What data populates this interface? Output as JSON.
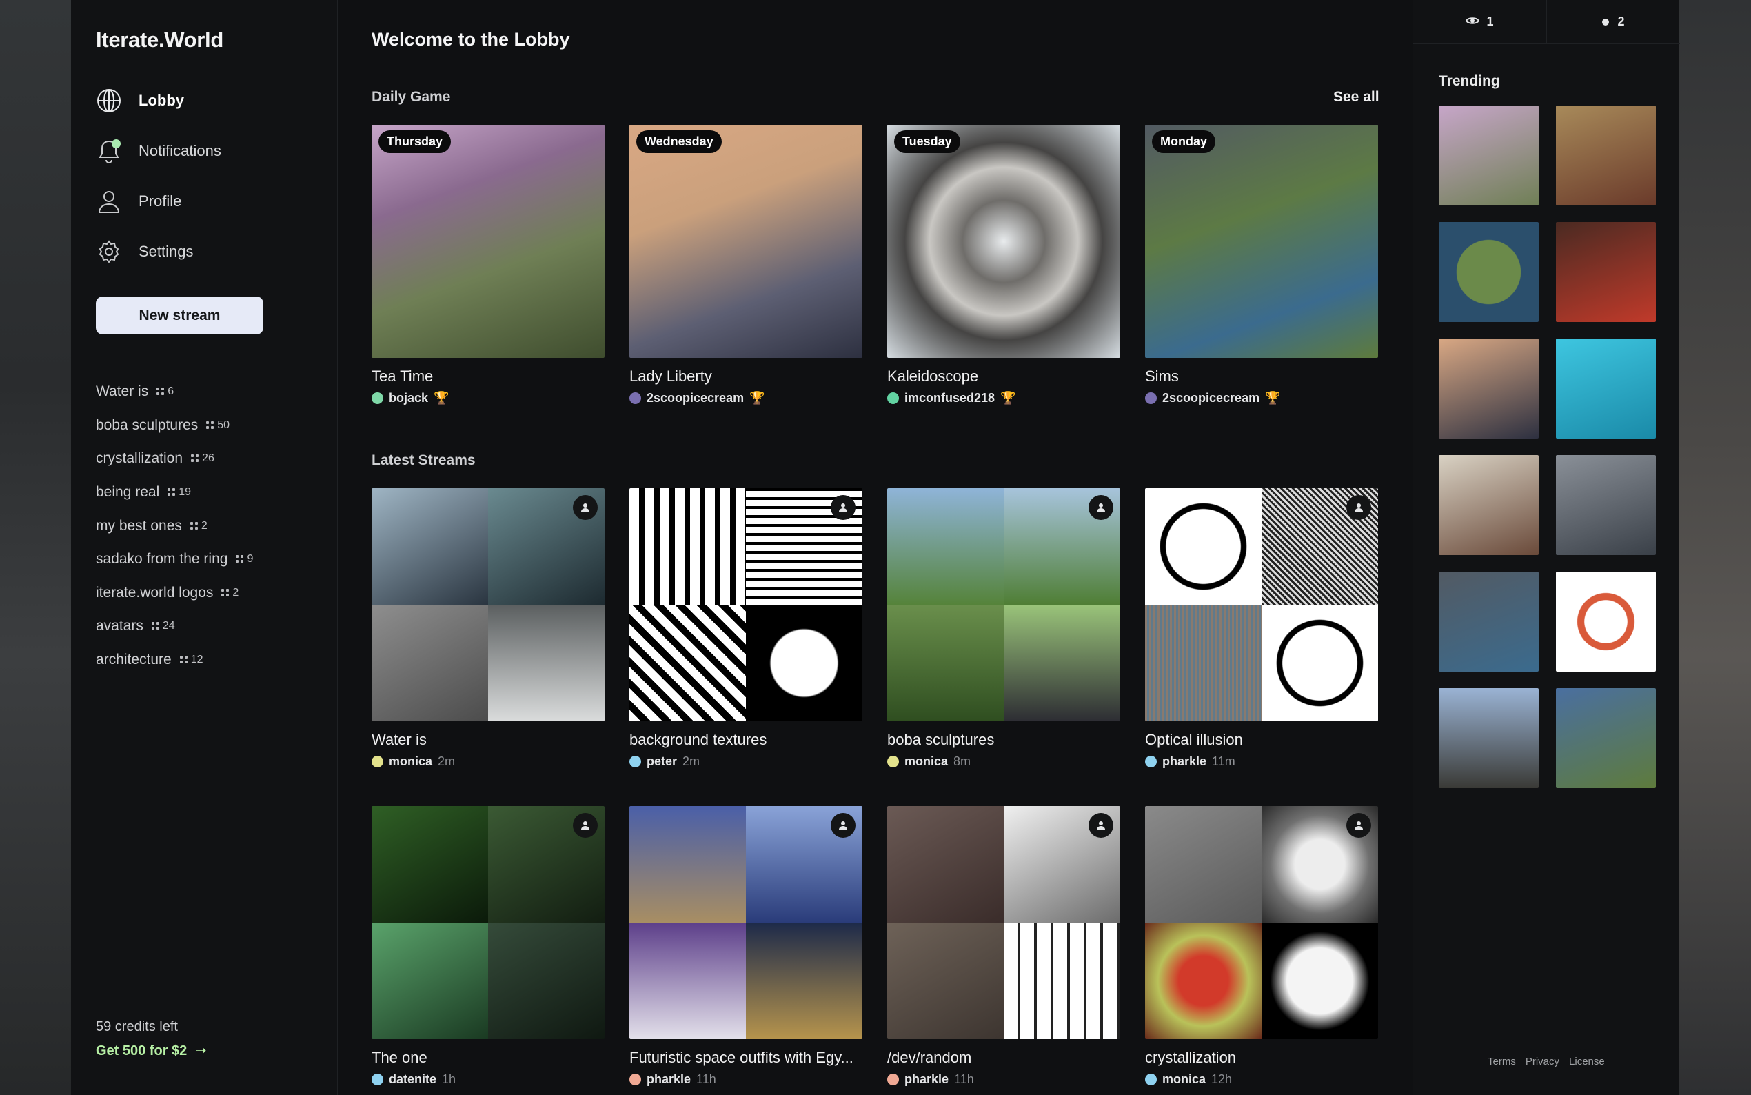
{
  "brand": "Iterate.World",
  "nav": [
    {
      "label": "Lobby",
      "icon": "globe-icon",
      "active": true
    },
    {
      "label": "Notifications",
      "icon": "bell-icon"
    },
    {
      "label": "Profile",
      "icon": "user-icon"
    },
    {
      "label": "Settings",
      "icon": "gear-icon"
    }
  ],
  "new_stream_label": "New stream",
  "stream_list": [
    {
      "name": "Water is",
      "count": "6"
    },
    {
      "name": "boba sculptures",
      "count": "50"
    },
    {
      "name": "crystallization",
      "count": "26"
    },
    {
      "name": "being real",
      "count": "19"
    },
    {
      "name": "my best ones",
      "count": "2"
    },
    {
      "name": "sadako from the ring",
      "count": "9"
    },
    {
      "name": "iterate.world logos",
      "count": "2"
    },
    {
      "name": "avatars",
      "count": "24"
    },
    {
      "name": "architecture",
      "count": "12"
    }
  ],
  "credits": "59 credits left",
  "upsell": "Get 500 for $2",
  "main": {
    "title": "Welcome to the Lobby",
    "daily_title": "Daily Game",
    "see_all": "See all",
    "latest_title": "Latest Streams"
  },
  "daily": [
    {
      "day": "Thursday",
      "title": "Tea Time",
      "author": "bojack",
      "avatar_color": "#7fd8a8",
      "bg": "linear-gradient(160deg,#c7a6c9 0%,#8a6a8f 30%,#6f7f55 60%,#3f4d2e 100%)"
    },
    {
      "day": "Wednesday",
      "title": "Lady Liberty",
      "author": "2scoopicecream",
      "avatar_color": "#7a6fb0",
      "bg": "linear-gradient(160deg,#d9a884 0%,#caa07c 35%,#5d5f73 70%,#2d3040 100%)"
    },
    {
      "day": "Tuesday",
      "title": "Kaleidoscope",
      "author": "imconfused218",
      "avatar_color": "#62d3a2",
      "bg": "radial-gradient(circle at 50% 50%,#e9ecee 0%,#6f6d6a 25%,#c9c7c3 45%,#454443 60%,#d6dde2 100%)"
    },
    {
      "day": "Monday",
      "title": "Sims",
      "author": "2scoopicecream",
      "avatar_color": "#7a6fb0",
      "bg": "linear-gradient(160deg,#525a63 0%,#5d7a45 40%,#3b6b8e 75%,#5e7b3c 100%)"
    }
  ],
  "latest": [
    {
      "title": "Water is",
      "author": "monica",
      "time": "2m",
      "avatar_color": "#e3e28c",
      "quads": [
        "linear-gradient(150deg,#9fb5c4,#2a3540)",
        "linear-gradient(150deg,#6a8a90,#1d2a30)",
        "linear-gradient(150deg,#8e8e8e,#4c4c4c)",
        "linear-gradient(180deg,#5b5f60,#dadcdc)"
      ]
    },
    {
      "title": "background textures",
      "author": "peter",
      "time": "2m",
      "avatar_color": "#8fd2f0",
      "quads": [
        "repeating-linear-gradient(90deg,#fff 0 14px,#000 14px 22px)",
        "repeating-linear-gradient(0deg,#fff 0 9px,#000 9px 13px)",
        "repeating-linear-gradient(45deg,#fff 0 12px,#000 12px 22px)",
        "radial-gradient(circle,#fff 0 40%,#000 42%)"
      ]
    },
    {
      "title": "boba sculptures",
      "author": "monica",
      "time": "8m",
      "avatar_color": "#e3e28c",
      "quads": [
        "linear-gradient(180deg,#8fb4d8,#55833a)",
        "linear-gradient(180deg,#a7c4dc,#4f7e35)",
        "linear-gradient(180deg,#6a8f4c,#2f4e20)",
        "linear-gradient(180deg,#9ac47a,#2d2d33)"
      ]
    },
    {
      "title": "Optical illusion",
      "author": "pharkle",
      "time": "11m",
      "avatar_color": "#8fd2f0",
      "quads": [
        "radial-gradient(circle,#fff 0 45%,#000 46% 52%,#fff 53%)",
        "repeating-linear-gradient(45deg,#222 0 3px,#ddd 3px 6px)",
        "repeating-linear-gradient(90deg,#8a7a6e 0 3px,#5f7a8c 3px 6px)",
        "radial-gradient(circle,#fff 0 45%,#000 46% 52%,#fff 53%)"
      ]
    },
    {
      "title": "The one",
      "author": "datenite",
      "time": "1h",
      "avatar_color": "#8fd2f0",
      "quads": [
        "linear-gradient(150deg,#2f5f25,#0b1a0a)",
        "linear-gradient(150deg,#3b5a34,#121d11)",
        "linear-gradient(150deg,#5aa36b,#1a3a22)",
        "linear-gradient(150deg,#354b3a,#0f1811)"
      ]
    },
    {
      "title": "Futuristic space outfits with Egy...",
      "author": "pharkle",
      "time": "11h",
      "avatar_color": "#f0a994",
      "quads": [
        "linear-gradient(180deg,#4a5fa8,#a88e63)",
        "linear-gradient(180deg,#8aa3d8,#2a3c7a)",
        "linear-gradient(180deg,#5d3f8a,#e3e0ea)",
        "linear-gradient(180deg,#1d2a4a,#b6944c)"
      ]
    },
    {
      "title": "/dev/random",
      "author": "pharkle",
      "time": "11h",
      "avatar_color": "#f0a994",
      "quads": [
        "linear-gradient(150deg,#6b5a55,#3a2c2a)",
        "linear-gradient(150deg,#f0f0f0,#6c6c6c)",
        "linear-gradient(150deg,#6e6258,#3d3530)",
        "repeating-linear-gradient(90deg,#fff 0 20px,#222 20px 24px)"
      ]
    },
    {
      "title": "crystallization",
      "author": "monica",
      "time": "12h",
      "avatar_color": "#8fd2f0",
      "quads": [
        "linear-gradient(150deg,#8a8a8a,#5a5a5a)",
        "radial-gradient(circle,#ededed 0 30%,#707070 60%,#2a2a2a)",
        "radial-gradient(circle,#d23a2a 0 30%,#b9c25a 55%,#6a2a1a)",
        "radial-gradient(circle,#f4f4f4 0 40%,#000 60%)"
      ]
    }
  ],
  "right": {
    "viewers": "1",
    "online": "2",
    "trending_title": "Trending"
  },
  "trending": [
    "linear-gradient(160deg,#c7a6c9,#6f7f55)",
    "linear-gradient(160deg,#a88a5a,#6a3a2a)",
    "radial-gradient(circle,#6b8a4a 0 45%,#2b4f6c 46%)",
    "linear-gradient(160deg,#4a2a22,#c13a2a)",
    "linear-gradient(160deg,#d9a884,#2d3040)",
    "linear-gradient(160deg,#3ec6e0,#1a8aa8)",
    "linear-gradient(160deg,#d9d2c4,#6a4a3a)",
    "linear-gradient(160deg,#8a9098,#3a4048)",
    "linear-gradient(160deg,#525a63,#3b6b8e)",
    "radial-gradient(circle,#fff 0 30%,#d95a3a 31% 40%,#fff 41%)",
    "linear-gradient(180deg,#9ab3d4,#3a3a36)",
    "linear-gradient(160deg,#4a6fa0,#5e7b3c)"
  ],
  "footer": {
    "terms": "Terms",
    "privacy": "Privacy",
    "license": "License"
  }
}
